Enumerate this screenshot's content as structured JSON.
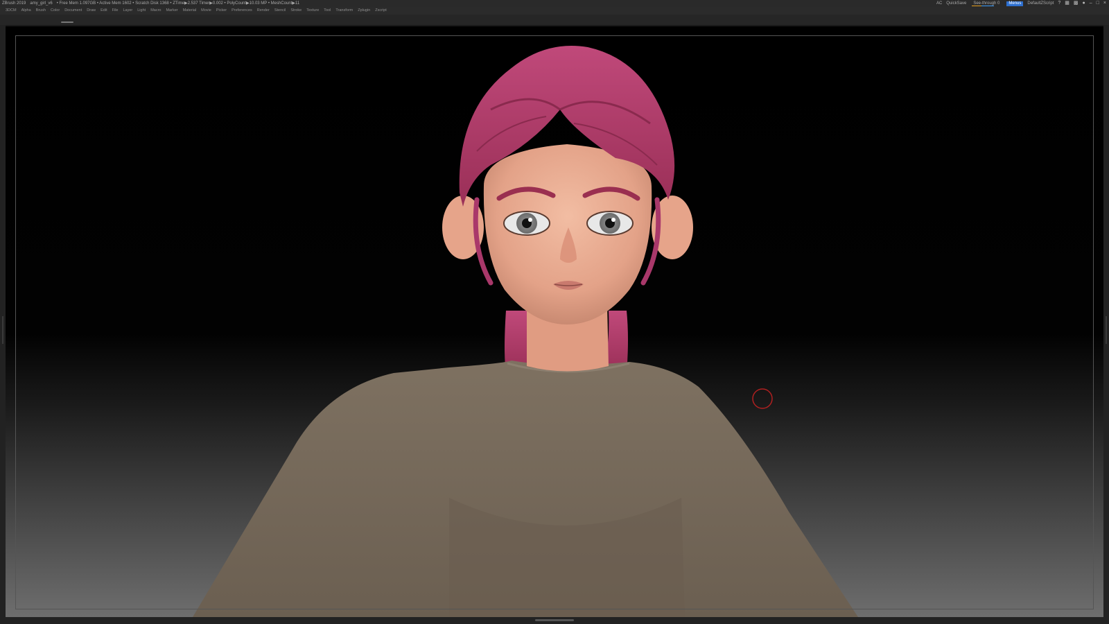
{
  "titlebar": {
    "app": "ZBrush 2019",
    "document": "amy_girl_v6",
    "stats": "• Free Mem 1.097GB • Active Mem 1602 • Scratch Disk 1368 • ZTime▶2.537 Timer▶0.002 • PolyCount▶10.03 MP • MeshCount▶11",
    "ac": "AC",
    "quicksave": "QuickSave",
    "see_through": "See-through 0",
    "menus_button": "Menus",
    "script": "DefaultZScript"
  },
  "menubar": {
    "items": [
      "3DCM",
      "Alpha",
      "Brush",
      "Color",
      "Document",
      "Draw",
      "Edit",
      "File",
      "Layer",
      "Light",
      "Macro",
      "Marker",
      "Material",
      "Movie",
      "Picker",
      "Preferences",
      "Render",
      "Stencil",
      "Stroke",
      "Texture",
      "Tool",
      "Transform",
      "Zplugin",
      "Zscript"
    ]
  },
  "colors": {
    "hair": "#a93a62",
    "skin": "#e7a88e",
    "shirt": "#76695a",
    "accent": "#2d6fcf",
    "cursor": "#b02020"
  },
  "icons": [
    "help-icon",
    "layout-icon",
    "palette-icon",
    "lock-icon",
    "minimize-icon",
    "restore-icon",
    "close-icon"
  ]
}
